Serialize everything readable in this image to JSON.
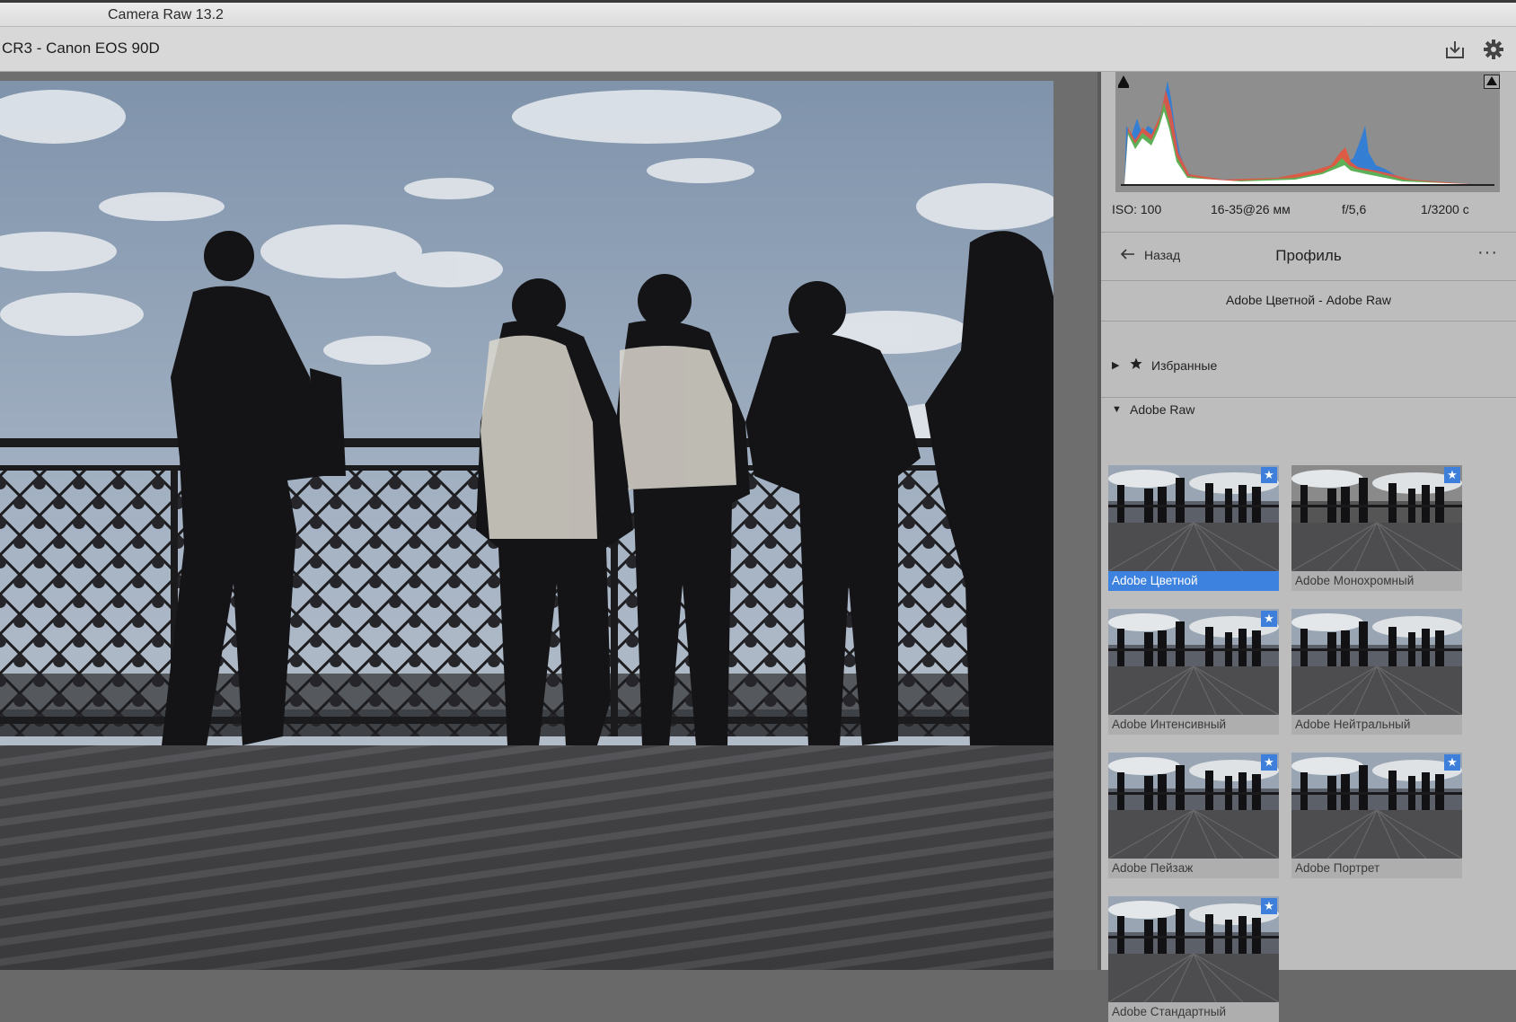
{
  "window": {
    "title": "Camera Raw 13.2"
  },
  "file": {
    "name": "CR3  -  Canon EOS 90D"
  },
  "toolbar": {
    "save_icon": "save-icon",
    "settings_icon": "gear-icon"
  },
  "histogram": {
    "colors": {
      "red": "#e4553d",
      "blue": "#2f7ed7",
      "green": "#49c05a",
      "yellow": "#e6d24a",
      "white": "#ffffff"
    }
  },
  "exif": {
    "iso": "ISO: 100",
    "lens": "16-35@26 мм",
    "aperture": "f/5,6",
    "shutter": "1/3200 с"
  },
  "nav": {
    "back_label": "Назад",
    "title": "Профиль",
    "more": "···"
  },
  "current_profile": "Adobe Цветной - Adobe Raw",
  "groups": {
    "favorites": "Избранные",
    "adobe_raw": "Adobe Raw"
  },
  "profiles": [
    {
      "name": "Adobe Цветной",
      "favorite": true,
      "selected": true
    },
    {
      "name": "Adobe Монохромный",
      "favorite": true,
      "selected": false
    },
    {
      "name": "Adobe Интенсивный",
      "favorite": true,
      "selected": false
    },
    {
      "name": "Adobe Нейтральный",
      "favorite": false,
      "selected": false
    },
    {
      "name": "Adobe Пейзаж",
      "favorite": true,
      "selected": false
    },
    {
      "name": "Adobe Портрет",
      "favorite": true,
      "selected": false
    },
    {
      "name": "Adobe Стандартный",
      "favorite": true,
      "selected": false
    }
  ],
  "colors": {
    "accent": "#3e82e0",
    "panel": "#bdbdbd",
    "canvas": "#6e6e6e"
  }
}
